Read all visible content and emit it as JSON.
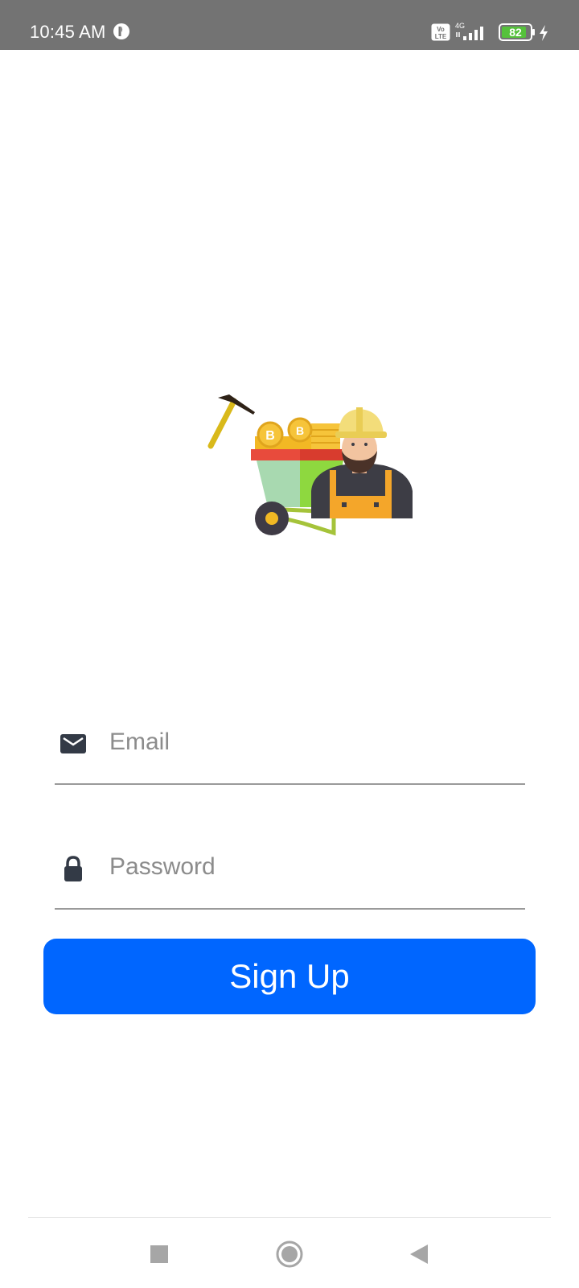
{
  "status_bar": {
    "time": "10:45 AM",
    "network_type": "4G",
    "volte_label": "Vo LTE",
    "battery_level": "82",
    "icons": [
      "app-notification-icon",
      "volte-icon",
      "signal-icon",
      "battery-icon",
      "charging-icon"
    ]
  },
  "illustration": {
    "icon": "crypto-miner-illustration"
  },
  "form": {
    "email": {
      "placeholder": "Email",
      "value": "",
      "icon": "mail-icon"
    },
    "password": {
      "placeholder": "Password",
      "value": "",
      "icon": "lock-icon"
    },
    "submit_label": "Sign Up"
  },
  "nav_bar": {
    "recent_icon": "square-icon",
    "home_icon": "circle-icon",
    "back_icon": "triangle-back-icon"
  },
  "colors": {
    "status_bar": "#737373",
    "primary_button": "#0066ff",
    "background": "#ffffff",
    "battery_green": "#55c13b"
  }
}
